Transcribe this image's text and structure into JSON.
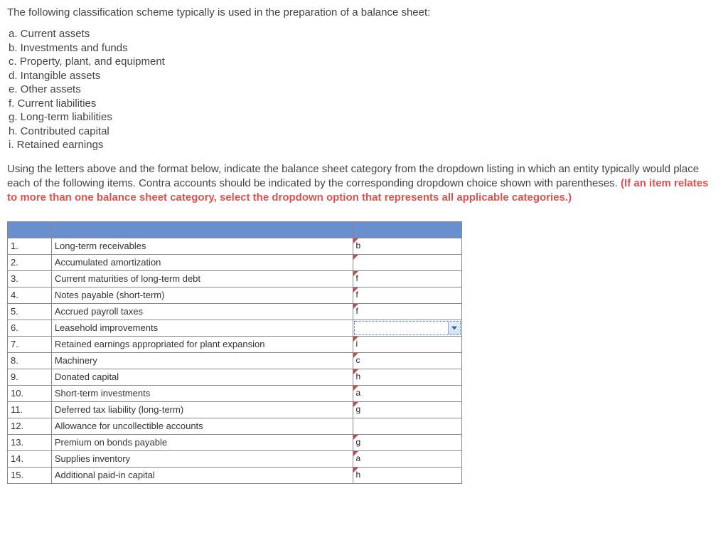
{
  "intro": "The following classification scheme typically is used in the preparation of a balance sheet:",
  "scheme": [
    "a. Current assets",
    "b. Investments and funds",
    "c. Property, plant, and equipment",
    "d. Intangible assets",
    "e. Other assets",
    "f. Current liabilities",
    "g. Long-term liabilities",
    "h. Contributed capital",
    "i. Retained earnings"
  ],
  "instructions_plain": "Using the letters above and the format below, indicate the balance sheet category from the dropdown listing in which an entity typically would place each of the following items. Contra accounts should be indicated by the corresponding dropdown choice shown with parentheses. ",
  "instructions_red": "(If an item relates to more than one balance sheet category, select the dropdown option that represents all applicable categories.)",
  "rows": [
    {
      "n": "1.",
      "desc": "Long-term receivables",
      "ans": "b",
      "mark": true
    },
    {
      "n": "2.",
      "desc": "Accumulated amortization",
      "ans": "",
      "mark": true
    },
    {
      "n": "3.",
      "desc": "Current maturities of long-term debt",
      "ans": "f",
      "mark": true
    },
    {
      "n": "4.",
      "desc": "Notes payable (short-term)",
      "ans": "f",
      "mark": true
    },
    {
      "n": "5.",
      "desc": "Accrued payroll taxes",
      "ans": "f",
      "mark": true
    },
    {
      "n": "6.",
      "desc": "Leasehold improvements",
      "ans": "",
      "active": true
    },
    {
      "n": "7.",
      "desc": "Retained earnings appropriated for plant expansion",
      "ans": "i",
      "mark": true
    },
    {
      "n": "8.",
      "desc": "Machinery",
      "ans": "c",
      "mark": true
    },
    {
      "n": "9.",
      "desc": "Donated capital",
      "ans": "h",
      "mark": true
    },
    {
      "n": "10.",
      "desc": "Short-term investments",
      "ans": "a",
      "mark": true
    },
    {
      "n": "11.",
      "desc": "Deferred tax liability (long-term)",
      "ans": "g",
      "mark": true
    },
    {
      "n": "12.",
      "desc": "Allowance for uncollectible accounts",
      "ans": "",
      "mark": false
    },
    {
      "n": "13.",
      "desc": "Premium on bonds payable",
      "ans": "g",
      "mark": true
    },
    {
      "n": "14.",
      "desc": "Supplies inventory",
      "ans": "a",
      "mark": true
    },
    {
      "n": "15.",
      "desc": "Additional paid-in capital",
      "ans": "h",
      "mark": true
    }
  ]
}
